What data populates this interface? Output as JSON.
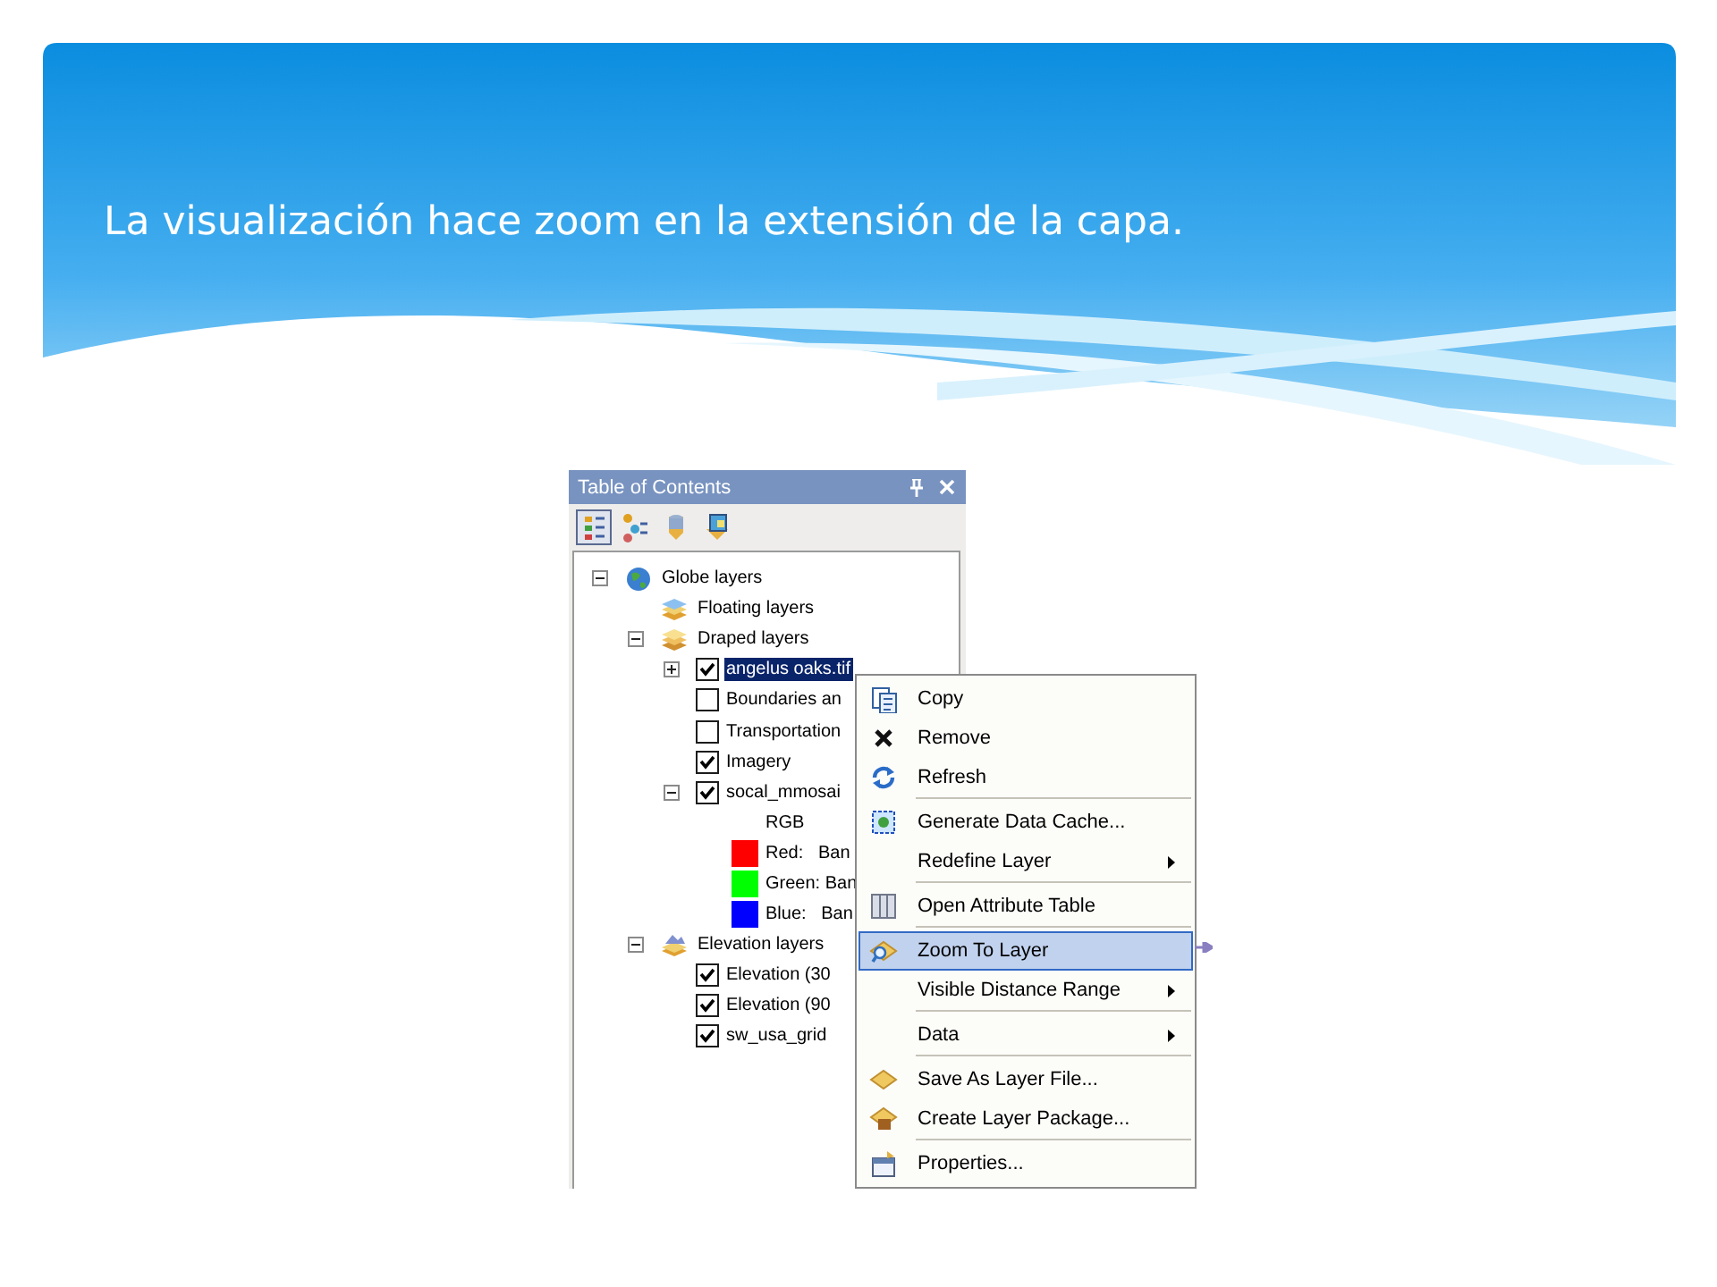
{
  "slide": {
    "title": "La visualización hace zoom en la extensión de la capa."
  },
  "panel": {
    "title": "Table of Contents",
    "toolbar": [
      {
        "kind": "list-by-drawing-order",
        "selected": true
      },
      {
        "kind": "list-by-source",
        "selected": false
      },
      {
        "kind": "list-by-visibility",
        "selected": false
      },
      {
        "kind": "list-by-selection",
        "selected": false
      }
    ],
    "tree": [
      {
        "kind": "globe",
        "label": "Globe layers",
        "selected": false,
        "expanded": true,
        "children": [
          {
            "kind": "floating",
            "label": "Floating layers",
            "selected": false
          },
          {
            "kind": "draped",
            "label": "Draped layers",
            "selected": false,
            "expanded": true,
            "children": [
              {
                "kind": "layer",
                "label": "angelus oaks.tif",
                "checked": true,
                "selected": true,
                "expanded": false
              },
              {
                "kind": "layer",
                "label": "Boundaries an",
                "checked": false,
                "selected": false
              },
              {
                "kind": "layer",
                "label": "Transportation",
                "checked": false,
                "selected": false
              },
              {
                "kind": "layer",
                "label": "Imagery",
                "checked": true,
                "selected": false
              },
              {
                "kind": "layer",
                "label": "socal_mmosai",
                "checked": true,
                "selected": false,
                "expanded": true,
                "children": [
                  {
                    "kind": "heading",
                    "label": "RGB",
                    "selected": false
                  },
                  {
                    "kind": "legend",
                    "label": "Red:   Ban",
                    "color": "#ff0000",
                    "selected": false
                  },
                  {
                    "kind": "legend",
                    "label": "Green: Ban",
                    "color": "#00ff00",
                    "selected": false
                  },
                  {
                    "kind": "legend",
                    "label": "Blue:   Ban",
                    "color": "#0000ff",
                    "selected": false
                  }
                ]
              }
            ]
          },
          {
            "kind": "elevation",
            "label": "Elevation layers",
            "selected": false,
            "expanded": true,
            "children": [
              {
                "kind": "layer",
                "label": "Elevation (30",
                "checked": true,
                "selected": false
              },
              {
                "kind": "layer",
                "label": "Elevation (90",
                "checked": true,
                "selected": false
              },
              {
                "kind": "layer",
                "label": "sw_usa_grid",
                "checked": true,
                "selected": false
              }
            ]
          }
        ]
      }
    ]
  },
  "context_menu": [
    {
      "label": "Copy",
      "highlighted": false,
      "submenu": false,
      "separator_after": false
    },
    {
      "label": "Remove",
      "highlighted": false,
      "submenu": false,
      "separator_after": false
    },
    {
      "label": "Refresh",
      "highlighted": false,
      "submenu": false,
      "separator_after": true
    },
    {
      "label": "Generate Data Cache...",
      "highlighted": false,
      "submenu": false,
      "separator_after": false
    },
    {
      "label": "Redefine Layer",
      "highlighted": false,
      "submenu": true,
      "separator_after": true
    },
    {
      "label": "Open Attribute Table",
      "highlighted": false,
      "submenu": false,
      "separator_after": true
    },
    {
      "label": "Zoom To Layer",
      "highlighted": true,
      "submenu": false,
      "separator_after": false
    },
    {
      "label": "Visible Distance Range",
      "highlighted": false,
      "submenu": true,
      "separator_after": true
    },
    {
      "label": "Data",
      "highlighted": false,
      "submenu": true,
      "separator_after": true
    },
    {
      "label": "Save As Layer File...",
      "highlighted": false,
      "submenu": false,
      "separator_after": false
    },
    {
      "label": "Create Layer Package...",
      "highlighted": false,
      "submenu": false,
      "separator_after": true
    },
    {
      "label": "Properties...",
      "highlighted": false,
      "submenu": false,
      "separator_after": false
    }
  ]
}
